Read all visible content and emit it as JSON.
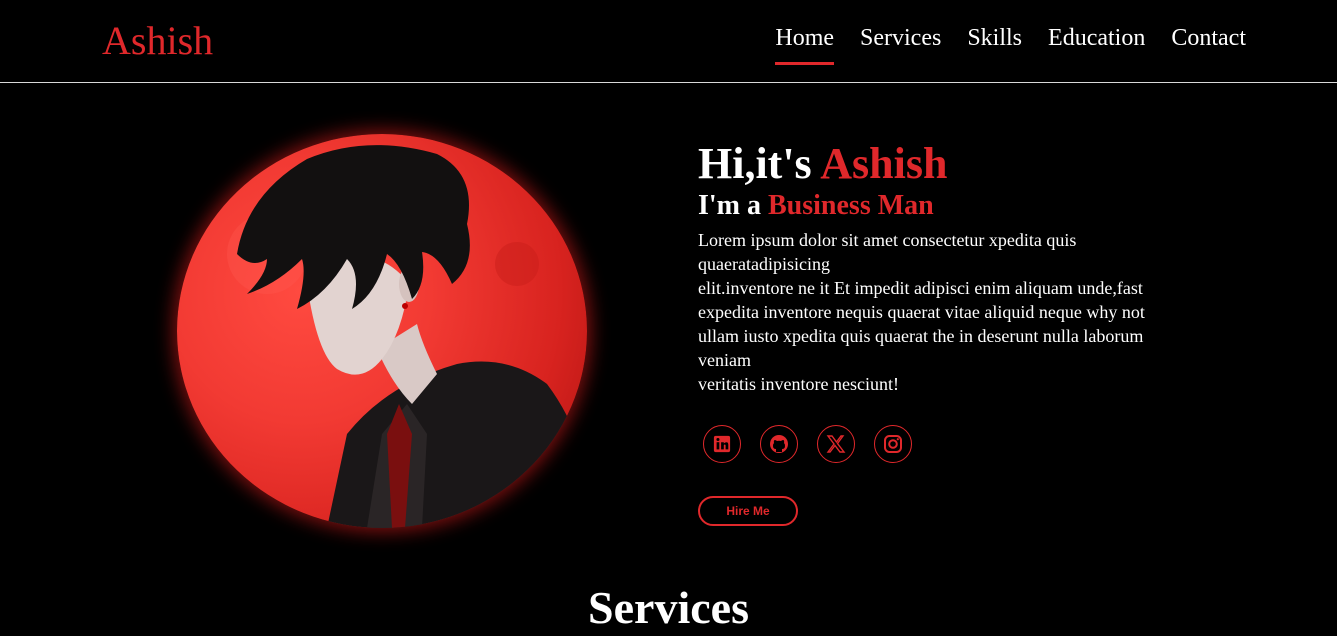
{
  "brand": {
    "logo": "Ashish"
  },
  "nav": {
    "items": [
      {
        "label": "Home",
        "active": true
      },
      {
        "label": "Services",
        "active": false
      },
      {
        "label": "Skills",
        "active": false
      },
      {
        "label": "Education",
        "active": false
      },
      {
        "label": "Contact",
        "active": false
      }
    ]
  },
  "hero": {
    "greeting_prefix": "Hi,it's ",
    "greeting_name": "Ashish",
    "role_prefix": "I'm a ",
    "role_title": "Business Man",
    "bio": "Lorem ipsum dolor sit amet consectetur xpedita quis quaeratadipisicing\nelit.inventore ne it Et impedit adipisci enim aliquam unde,fast expedita inventore nequis quaerat vitae aliquid neque why not ullam iusto xpedita quis quaerat the in deserunt nulla laborum veniam\nveritatis inventore nesciunt!",
    "hire_label": "Hire Me"
  },
  "socials": [
    {
      "icon": "linkedin-icon"
    },
    {
      "icon": "github-icon"
    },
    {
      "icon": "x-icon"
    },
    {
      "icon": "instagram-icon"
    }
  ],
  "sections": {
    "services_title": "Services"
  },
  "colors": {
    "accent": "#e0282b",
    "background": "#000000",
    "text": "#ffffff"
  }
}
